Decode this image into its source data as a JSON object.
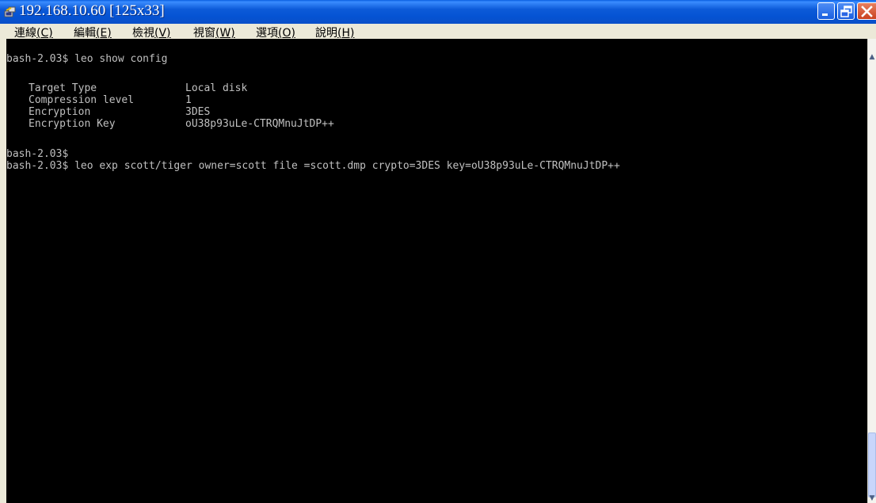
{
  "window": {
    "title": "192.168.10.60 [125x33]"
  },
  "menu": [
    {
      "label": "連線",
      "accel": "(C)"
    },
    {
      "label": "編輯",
      "accel": "(E)"
    },
    {
      "label": "檢視",
      "accel": "(V)"
    },
    {
      "label": "視窗",
      "accel": "(W)"
    },
    {
      "label": "選項",
      "accel": "(O)"
    },
    {
      "label": "說明",
      "accel": "(H)"
    }
  ],
  "terminal": {
    "lines": [
      "bash-2.03$ leo show config",
      "",
      "bash-2.03$",
      "bash-2.03$ leo exp scott/tiger owner=scott file =scott.dmp crypto=3DES key=oU38p93uLe-CTRQMnuJtDP++"
    ],
    "config": [
      {
        "key": "Target Type",
        "value": "Local disk"
      },
      {
        "key": "Compression level",
        "value": "1"
      },
      {
        "key": "Encryption",
        "value": "3DES"
      },
      {
        "key": "Encryption Key",
        "value": "oU38p93uLe-CTRQMnuJtDP++"
      }
    ],
    "text_color": "#c0c0c0",
    "background": "#000000"
  },
  "icons": {
    "app": "putty-icon",
    "minimize": "minimize-icon",
    "maximize": "restore-icon",
    "close": "close-icon"
  }
}
